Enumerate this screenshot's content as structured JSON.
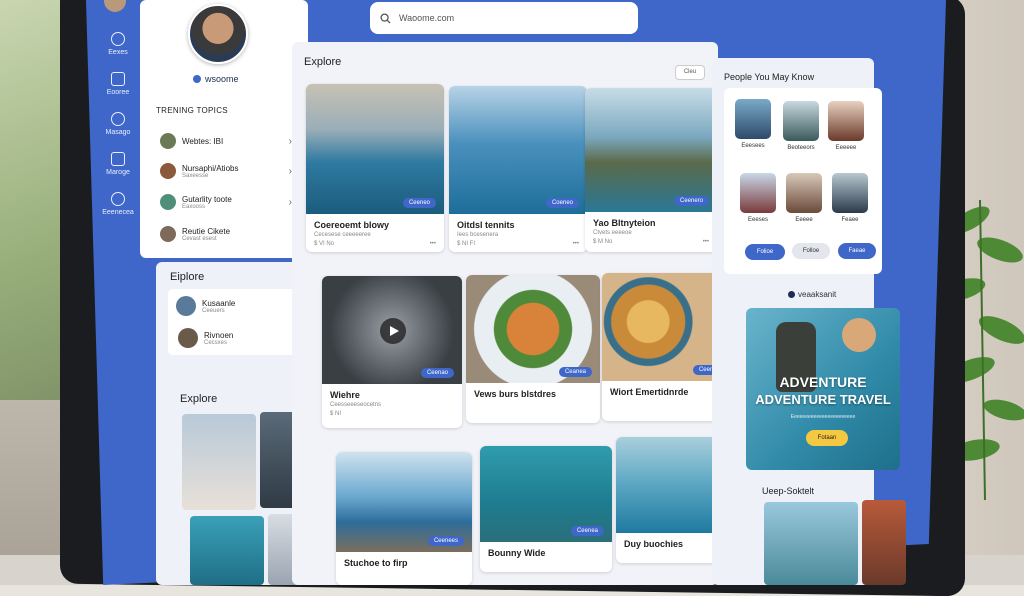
{
  "search": {
    "value": "Waoome.com"
  },
  "rail": [
    {
      "label": "Eexes",
      "icon": "compass-icon"
    },
    {
      "label": "Eooree",
      "icon": "document-icon"
    },
    {
      "label": "Masago",
      "icon": "message-icon"
    },
    {
      "label": "Maroge",
      "icon": "image-icon"
    },
    {
      "label": "Eeenecea",
      "icon": "settings-icon"
    }
  ],
  "profile": {
    "brand": "wsoome"
  },
  "trending": {
    "title": "TRENING TOPICS",
    "items": [
      {
        "name": "Webtes: IBI",
        "sub": ""
      },
      {
        "name": "Nursaphi/Atiobs",
        "sub": "Saxeesse"
      },
      {
        "name": "Gutarlity toote",
        "sub": "Eaxooss"
      },
      {
        "name": "Reutie Cikete",
        "sub": "Cevast esest"
      }
    ]
  },
  "explore_side": {
    "title": "Eiplore",
    "items": [
      {
        "name": "Kusaanle",
        "sub": "Ceeuers"
      },
      {
        "name": "Rivnoen",
        "sub": "Cecsxes"
      }
    ]
  },
  "explore_gallery": {
    "title": "Explore"
  },
  "main": {
    "title": "Explore",
    "view_button": "Cleu",
    "cards": [
      {
        "title": "Coereoemt blowy",
        "meta": "Cecesese ceeeeeree",
        "foot": "$ VI No",
        "badge": "Ceeneo"
      },
      {
        "title": "Oitdsl tennits",
        "meta": "Iees bcesenera",
        "foot": "$ NI FI",
        "badge": "Coeneo"
      },
      {
        "title": "Yao Bltnyteion",
        "meta": "Ctvets eeeeoe",
        "foot": "$ M No",
        "badge": "Ceenero"
      },
      {
        "title": "Wiehre",
        "meta": "Ceesseeeseocetns",
        "foot": "$ NI",
        "badge": "Ceenao"
      },
      {
        "title": "Vews burs blstdres",
        "meta": "",
        "foot": "",
        "badge": "Ceanea"
      },
      {
        "title": "Wiort Emertidnrde",
        "meta": "",
        "foot": "",
        "badge": "Ceeneo"
      },
      {
        "title": "Stuchoe to firp",
        "meta": "",
        "foot": "",
        "badge": "Ceenees"
      },
      {
        "title": "Bounny Wide",
        "meta": "",
        "foot": "",
        "badge": "Ceenea"
      },
      {
        "title": "Duy buochies",
        "meta": "",
        "foot": "",
        "badge": ""
      }
    ]
  },
  "people": {
    "title": "People You May Know",
    "list": [
      {
        "name": "Eeesees"
      },
      {
        "name": "Beoteeors"
      },
      {
        "name": "Eeeeee"
      },
      {
        "name": "Eeeses"
      },
      {
        "name": "Eeeee"
      },
      {
        "name": "Feaee"
      }
    ],
    "buttons": [
      "Folioe",
      "Folloe",
      "Faeae"
    ]
  },
  "ad": {
    "brand": "veaaksanit",
    "headline1": "ADVENTURE",
    "headline2": "ADVENTURE TRAVEL",
    "sub": "Eeeeeeeeeeeeeeeeeeeeeee",
    "button": "Fotaan"
  },
  "bottom_right": {
    "title": "Ueep-Soktelt"
  }
}
